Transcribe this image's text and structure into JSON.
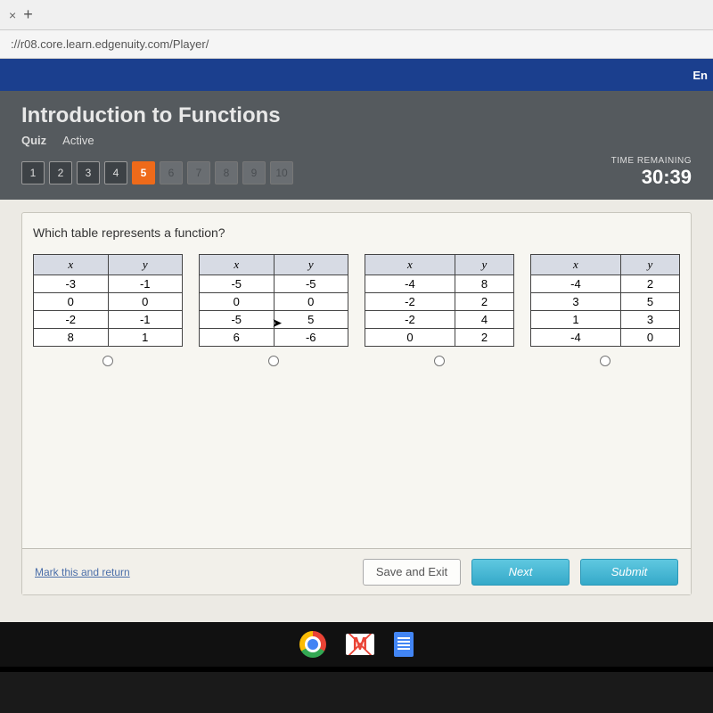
{
  "browser": {
    "tab_close": "×",
    "tab_plus": "+",
    "url": "://r08.core.learn.edgenuity.com/Player/"
  },
  "blue_strip": {
    "right_text": "En"
  },
  "lesson": {
    "title": "Introduction to Functions",
    "type": "Quiz",
    "status": "Active"
  },
  "nav": {
    "items": [
      "1",
      "2",
      "3",
      "4",
      "5",
      "6",
      "7",
      "8",
      "9",
      "10"
    ],
    "current_index": 4
  },
  "timer": {
    "label": "TIME REMAINING",
    "value": "30:39"
  },
  "question": {
    "prompt": "Which table represents a function?",
    "headers": {
      "x": "x",
      "y": "y"
    },
    "options": [
      {
        "rows": [
          [
            "-3",
            "-1"
          ],
          [
            "0",
            "0"
          ],
          [
            "-2",
            "-1"
          ],
          [
            "8",
            "1"
          ]
        ]
      },
      {
        "rows": [
          [
            "-5",
            "-5"
          ],
          [
            "0",
            "0"
          ],
          [
            "-5",
            "5"
          ],
          [
            "6",
            "-6"
          ]
        ]
      },
      {
        "rows": [
          [
            "-4",
            "8"
          ],
          [
            "-2",
            "2"
          ],
          [
            "-2",
            "4"
          ],
          [
            "0",
            "2"
          ]
        ]
      },
      {
        "rows": [
          [
            "-4",
            "2"
          ],
          [
            "3",
            "5"
          ],
          [
            "1",
            "3"
          ],
          [
            "-4",
            "0"
          ]
        ]
      }
    ]
  },
  "footer": {
    "mark": "Mark this and return",
    "save": "Save and Exit",
    "next": "Next",
    "submit": "Submit"
  }
}
